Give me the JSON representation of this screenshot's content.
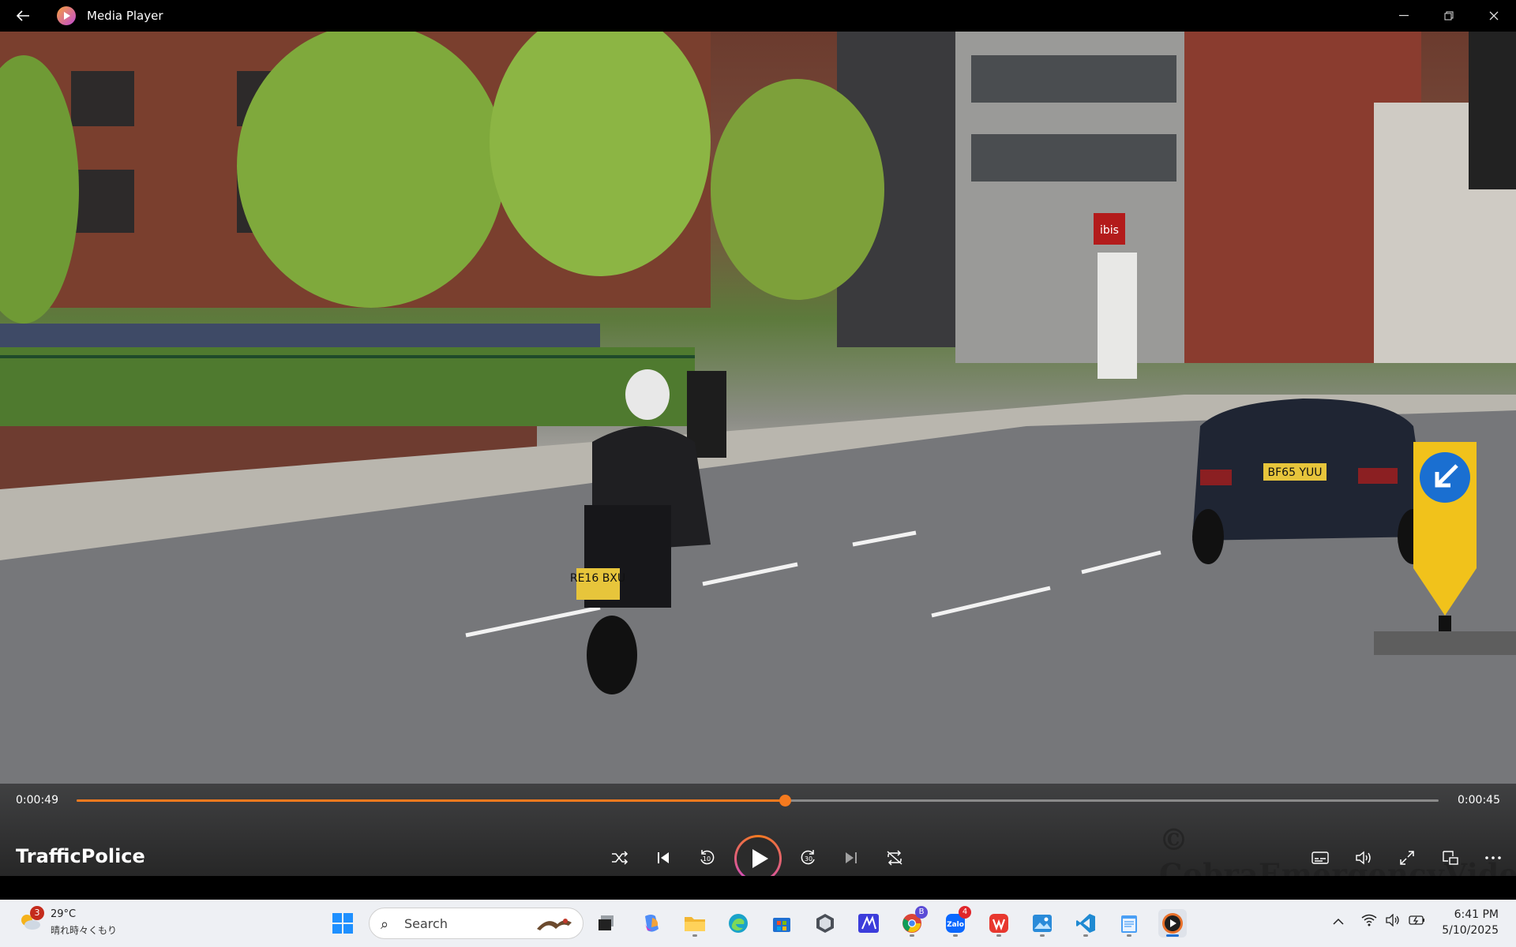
{
  "window": {
    "title": "Media Player",
    "back_icon": "back-arrow-icon",
    "minimize_icon": "minimize-icon",
    "restore_icon": "restore-icon",
    "close_icon": "close-icon"
  },
  "player": {
    "media_title": "TrafficPolice",
    "current_time": "0:00:49",
    "total_time": "0:00:45",
    "progress": 0.52,
    "accent_color": "#f57a1e",
    "watermark": "© CobraEmergencyVideos",
    "video": {
      "motorbike_plate": "RE16 BXU",
      "car_plate": "BF65 YUU",
      "hotel_sign": "ibis"
    },
    "controls": [
      "shuffle-icon",
      "previous-icon",
      "rewind-10-icon",
      "play-icon",
      "forward-30-icon",
      "next-icon",
      "repeat-icon"
    ],
    "right_controls": [
      "subtitles-icon",
      "volume-icon",
      "fullscreen-icon",
      "mini-player-icon",
      "more-icon"
    ]
  },
  "taskbar": {
    "weather": {
      "temperature": "29°C",
      "condition": "晴れ時々くもり",
      "badge": "3"
    },
    "search_placeholder": "Search",
    "apps": [
      {
        "name": "start",
        "icon": "windows-icon"
      },
      {
        "name": "task-view",
        "icon": "task-view-icon"
      },
      {
        "name": "copilot",
        "icon": "copilot-icon"
      },
      {
        "name": "file-explorer",
        "icon": "folder-icon"
      },
      {
        "name": "edge",
        "icon": "edge-icon"
      },
      {
        "name": "store",
        "icon": "store-icon"
      },
      {
        "name": "app-hexagon",
        "icon": "hexagon-icon"
      },
      {
        "name": "app-blue",
        "icon": "blue-app-icon"
      },
      {
        "name": "chrome",
        "icon": "chrome-icon",
        "badge": "B"
      },
      {
        "name": "zalo",
        "icon": "zalo-icon",
        "badge": "4"
      },
      {
        "name": "wps",
        "icon": "wps-icon"
      },
      {
        "name": "photos",
        "icon": "photos-icon"
      },
      {
        "name": "vscode",
        "icon": "vscode-icon"
      },
      {
        "name": "notepad",
        "icon": "notepad-icon"
      },
      {
        "name": "media-player",
        "icon": "media-player-icon"
      }
    ],
    "time": "6:41 PM",
    "date": "5/10/2025"
  }
}
